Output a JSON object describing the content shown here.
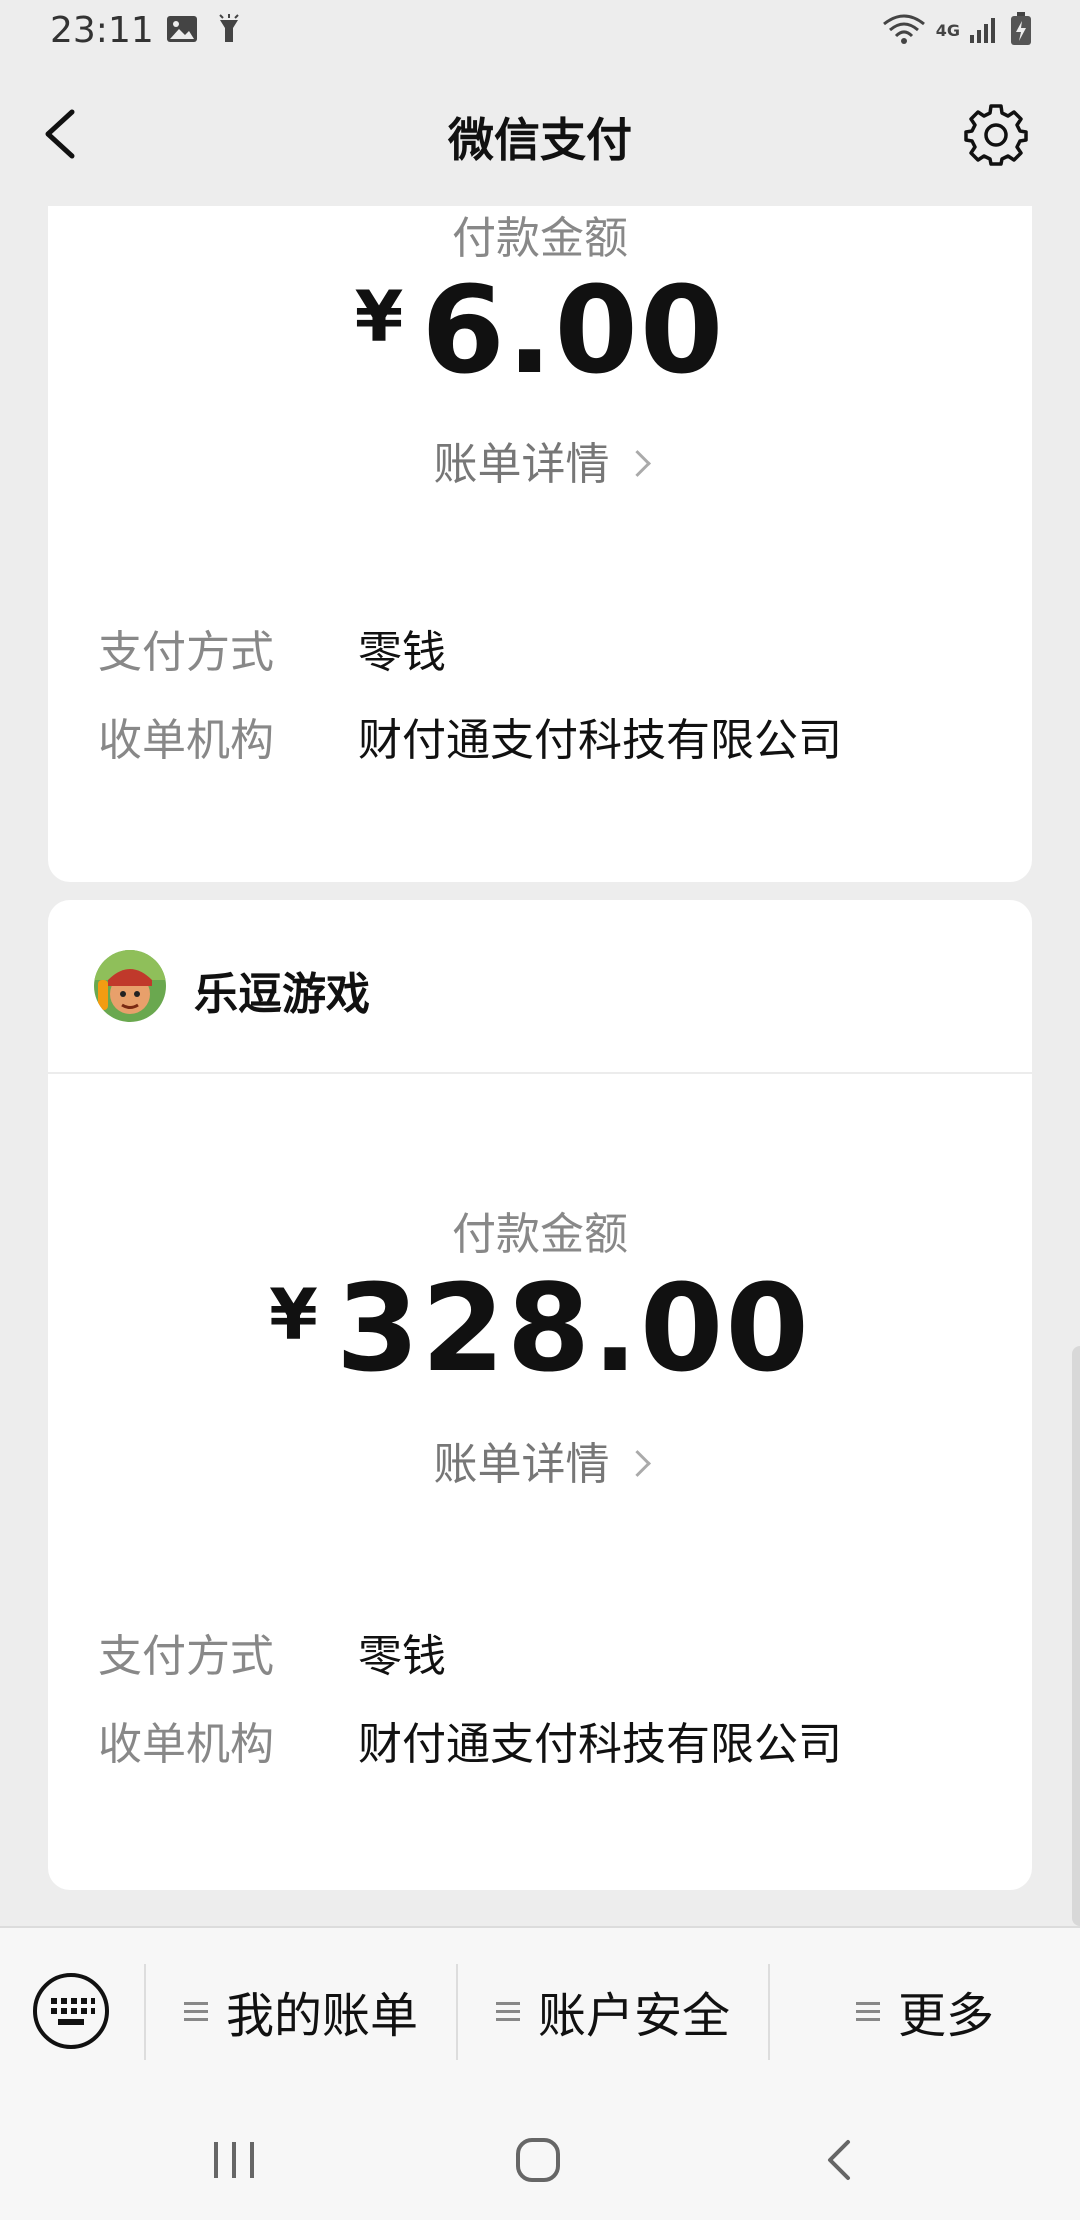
{
  "status_bar": {
    "time": "23:11",
    "network": "4G"
  },
  "header": {
    "title": "微信支付"
  },
  "cards": [
    {
      "amount_label": "付款金额",
      "currency": "¥",
      "amount": "6.00",
      "bill_detail": "账单详情",
      "payment_method_label": "支付方式",
      "payment_method": "零钱",
      "acquirer_label": "收单机构",
      "acquirer": "财付通支付科技有限公司"
    },
    {
      "merchant": "乐逗游戏",
      "amount_label": "付款金额",
      "currency": "¥",
      "amount": "328.00",
      "bill_detail": "账单详情",
      "payment_method_label": "支付方式",
      "payment_method": "零钱",
      "acquirer_label": "收单机构",
      "acquirer": "财付通支付科技有限公司"
    }
  ],
  "bottom_menu": {
    "items": [
      {
        "label": "我的账单"
      },
      {
        "label": "账户安全"
      },
      {
        "label": "更多"
      }
    ]
  }
}
